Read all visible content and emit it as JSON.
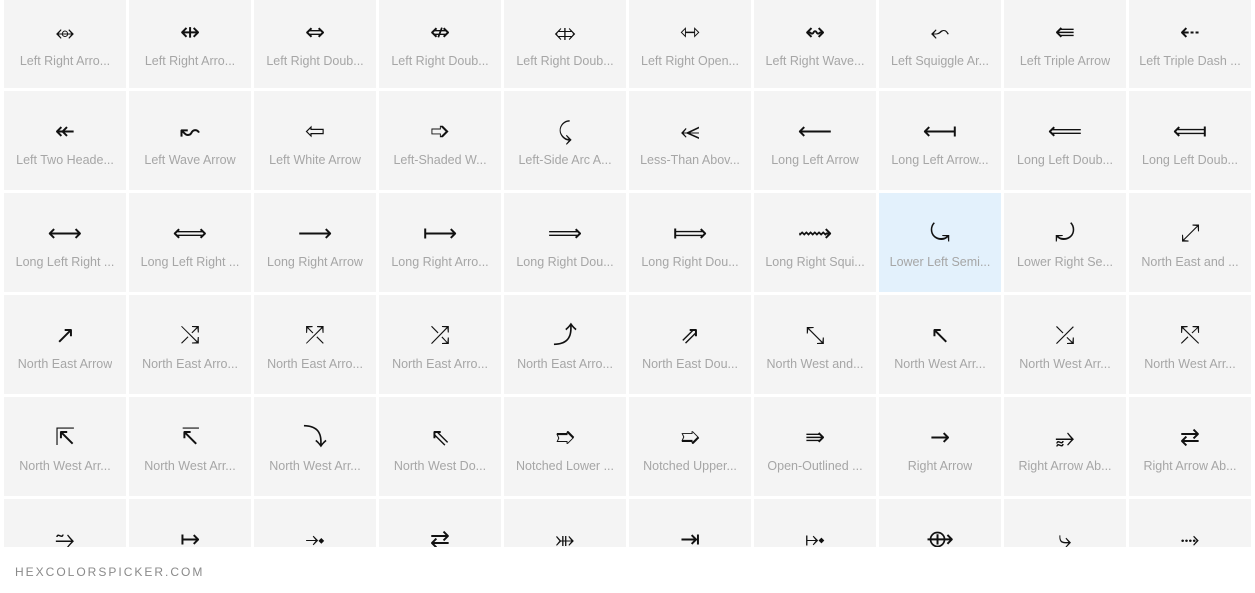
{
  "grid": {
    "selected_index": 27,
    "items": [
      {
        "glyph": "⥈",
        "label": "Left Right Arro..."
      },
      {
        "glyph": "⇹",
        "label": "Left Right Arro..."
      },
      {
        "glyph": "⇔",
        "label": "Left Right Doub..."
      },
      {
        "glyph": "⇎",
        "label": "Left Right Doub..."
      },
      {
        "glyph": "⤄",
        "label": "Left Right Doub..."
      },
      {
        "glyph": "⇿",
        "label": "Left Right Open..."
      },
      {
        "glyph": "↭",
        "label": "Left Right Wave..."
      },
      {
        "glyph": "⬿",
        "label": "Left Squiggle Ar..."
      },
      {
        "glyph": "⇚",
        "label": "Left Triple Arrow"
      },
      {
        "glyph": "⇠",
        "label": "Left Triple Dash ..."
      },
      {
        "glyph": "↞",
        "label": "Left Two Heade..."
      },
      {
        "glyph": "↜",
        "label": "Left Wave Arrow"
      },
      {
        "glyph": "⇦",
        "label": "Left White Arrow"
      },
      {
        "glyph": "➩",
        "label": "Left-Shaded W..."
      },
      {
        "glyph": "⤹",
        "label": "Left-Side Arc A..."
      },
      {
        "glyph": "⥷",
        "label": "Less-Than Abov..."
      },
      {
        "glyph": "⟵",
        "label": "Long Left Arrow"
      },
      {
        "glyph": "⟻",
        "label": "Long Left Arrow..."
      },
      {
        "glyph": "⟸",
        "label": "Long Left Doub..."
      },
      {
        "glyph": "⟽",
        "label": "Long Left Doub..."
      },
      {
        "glyph": "⟷",
        "label": "Long Left Right ..."
      },
      {
        "glyph": "⟺",
        "label": "Long Left Right ..."
      },
      {
        "glyph": "⟶",
        "label": "Long Right Arrow"
      },
      {
        "glyph": "⟼",
        "label": "Long Right Arro..."
      },
      {
        "glyph": "⟹",
        "label": "Long Right Dou..."
      },
      {
        "glyph": "⟾",
        "label": "Long Right Dou..."
      },
      {
        "glyph": "⟿",
        "label": "Long Right Squi..."
      },
      {
        "glyph": "⤿",
        "label": "Lower Left Semi..."
      },
      {
        "glyph": "⤾",
        "label": "Lower Right Se..."
      },
      {
        "glyph": "⤢",
        "label": "North East and ..."
      },
      {
        "glyph": "↗",
        "label": "North East Arrow"
      },
      {
        "glyph": "⤭",
        "label": "North East Arro..."
      },
      {
        "glyph": "⤱",
        "label": "North East Arro..."
      },
      {
        "glyph": "⤮",
        "label": "North East Arro..."
      },
      {
        "glyph": "⤴",
        "label": "North East Arro..."
      },
      {
        "glyph": "⇗",
        "label": "North East Dou..."
      },
      {
        "glyph": "⤡",
        "label": "North West and..."
      },
      {
        "glyph": "↖",
        "label": "North West Arr..."
      },
      {
        "glyph": "⤰",
        "label": "North West Arr..."
      },
      {
        "glyph": "⤲",
        "label": "North West Arr..."
      },
      {
        "glyph": "⇱",
        "label": "North West Arr..."
      },
      {
        "glyph": "↸",
        "label": "North West Arr..."
      },
      {
        "glyph": "⤵",
        "label": "North West Arr..."
      },
      {
        "glyph": "⇖",
        "label": "North West Do..."
      },
      {
        "glyph": "➱",
        "label": "Notched Lower ..."
      },
      {
        "glyph": "➯",
        "label": "Notched Upper..."
      },
      {
        "glyph": "⇛",
        "label": "Open-Outlined ..."
      },
      {
        "glyph": "→",
        "label": "Right Arrow"
      },
      {
        "glyph": "⥵",
        "label": "Right Arrow Ab..."
      },
      {
        "glyph": "⇄",
        "label": "Right Arrow Ab..."
      },
      {
        "glyph": "⥲",
        "label": ""
      },
      {
        "glyph": "↦",
        "label": ""
      },
      {
        "glyph": "⤞",
        "label": ""
      },
      {
        "glyph": "⇄",
        "label": ""
      },
      {
        "glyph": "⤕",
        "label": ""
      },
      {
        "glyph": "⇥",
        "label": ""
      },
      {
        "glyph": "⤠",
        "label": ""
      },
      {
        "glyph": "⟴",
        "label": ""
      },
      {
        "glyph": "⤷",
        "label": ""
      },
      {
        "glyph": "⤑",
        "label": ""
      }
    ]
  },
  "footer": {
    "brand": "HEXCOLORSPICKER.COM"
  }
}
